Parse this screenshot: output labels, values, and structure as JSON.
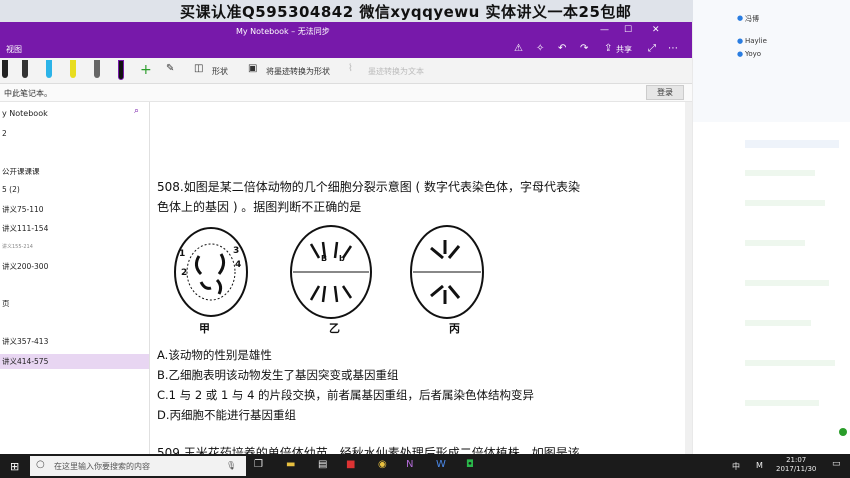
{
  "watermark": "买课认准Q595304842 微信xyqqyewu 实体讲义一本25包邮",
  "window": {
    "title": "My Notebook – 无法同步",
    "menu_view": "视图",
    "share_label": "共享"
  },
  "toolbar": {
    "shape_label": "形状",
    "ink_to_shape_label": "将墨迹转换为形状",
    "ink_to_text_label": "墨迹转换为文本"
  },
  "notebar": {
    "message": "中此笔记本。",
    "login_label": "登录"
  },
  "nav": {
    "notebook_title": "y Notebook",
    "items": [
      {
        "label": "2"
      },
      {
        "label": "公开课课课"
      },
      {
        "label": "5 (2)"
      },
      {
        "label": "讲义75-110"
      },
      {
        "label": "讲义111-154"
      },
      {
        "label": "讲义155-214"
      },
      {
        "label": "讲义200-300"
      },
      {
        "label": "页"
      },
      {
        "label": "讲义357-413"
      },
      {
        "label": "讲义414-575"
      }
    ]
  },
  "page": {
    "q508_line1": "508.如图是某二倍体动物的几个细胞分裂示意图 ( 数字代表染色体，字母代表染",
    "q508_line2": "色体上的基因 ) 。据图判断不正确的是",
    "cell_labels": [
      "甲",
      "乙",
      "丙"
    ],
    "cell_numbers": [
      "1",
      "2",
      "3",
      "4"
    ],
    "cell_genes": [
      "B",
      "b"
    ],
    "options": [
      "A.该动物的性别是雄性",
      "B.乙细胞表明该动物发生了基因突变或基因重组",
      "C.1 与 2 或 1 与 4 的片段交换，前者属基因重组，后者属染色体结构变异",
      "D.丙细胞不能进行基因重组"
    ],
    "q509_line1": "509.玉米花药培养的单倍体幼苗，经秋水仙素处理后形成二倍体植株。如图是该"
  },
  "chat": {
    "users": [
      "冯博",
      "Haylie",
      "Yoyo"
    ]
  },
  "taskbar": {
    "search_placeholder": "在这里输入你要搜索的内容",
    "ime": "中",
    "time": "21:07",
    "date": "2017/11/30"
  },
  "colors": {
    "onenote_purple": "#7719aa",
    "taskbar": "#1b1b1b"
  }
}
